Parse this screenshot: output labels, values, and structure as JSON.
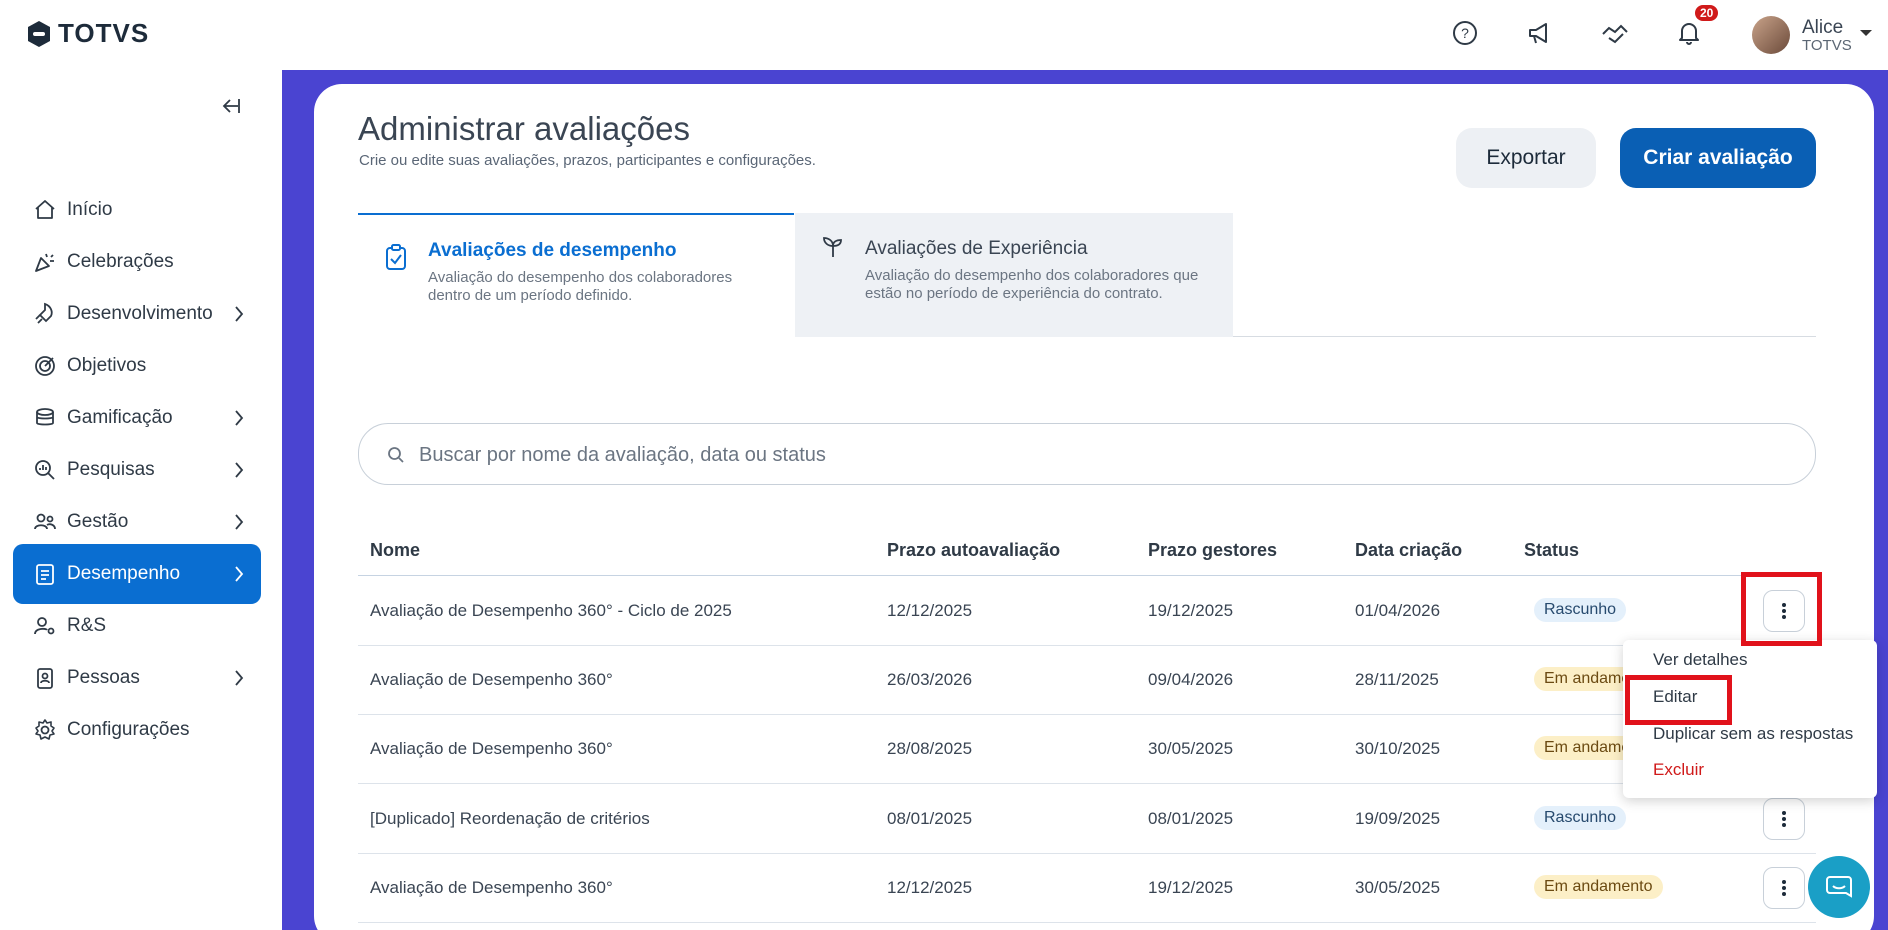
{
  "header": {
    "logo_text": "TOTVS",
    "notification_count": "20",
    "user_name": "Alice",
    "user_org": "TOTVS"
  },
  "sidebar": {
    "items": [
      {
        "label": "Início",
        "icon": "home-icon",
        "has_children": false
      },
      {
        "label": "Celebrações",
        "icon": "party-icon",
        "has_children": false
      },
      {
        "label": "Desenvolvimento",
        "icon": "rocket-icon",
        "has_children": true
      },
      {
        "label": "Objetivos",
        "icon": "target-icon",
        "has_children": false
      },
      {
        "label": "Gamificação",
        "icon": "coins-icon",
        "has_children": true
      },
      {
        "label": "Pesquisas",
        "icon": "search-chart-icon",
        "has_children": true
      },
      {
        "label": "Gestão",
        "icon": "people-icon",
        "has_children": true
      },
      {
        "label": "Desempenho",
        "icon": "clipboard-icon",
        "has_children": true,
        "active": true
      },
      {
        "label": "R&S",
        "icon": "recruit-icon",
        "has_children": false
      },
      {
        "label": "Pessoas",
        "icon": "badge-icon",
        "has_children": true
      },
      {
        "label": "Configurações",
        "icon": "gear-icon",
        "has_children": false
      }
    ]
  },
  "page": {
    "title": "Administrar avaliações",
    "subtitle": "Crie ou edite suas avaliações, prazos, participantes e configurações.",
    "export_label": "Exportar",
    "create_label": "Criar avaliação"
  },
  "tabs": [
    {
      "title": "Avaliações de desempenho",
      "desc": "Avaliação do desempenho dos colaboradores dentro de um período definido.",
      "active": true
    },
    {
      "title": "Avaliações de Experiência",
      "desc": "Avaliação do desempenho dos colaboradores que estão no período de experiência do contrato.",
      "active": false
    }
  ],
  "search": {
    "placeholder": "Buscar por nome da avaliação, data ou status"
  },
  "table": {
    "headers": [
      "Nome",
      "Prazo autoavaliação",
      "Prazo gestores",
      "Data criação",
      "Status"
    ],
    "rows": [
      [
        "Avaliação de Desempenho 360° - Ciclo de 2025",
        "12/12/2025",
        "19/12/2025",
        "01/04/2026",
        "Rascunho"
      ],
      [
        "Avaliação de Desempenho 360°",
        "26/03/2026",
        "09/04/2026",
        "28/11/2025",
        "Em andamento"
      ],
      [
        "Avaliação de Desempenho 360°",
        "28/08/2025",
        "30/05/2025",
        "30/10/2025",
        "Em andamento"
      ],
      [
        "[Duplicado] Reordenação de critérios",
        "08/01/2025",
        "08/01/2025",
        "19/09/2025",
        "Rascunho"
      ],
      [
        "Avaliação de Desempenho 360°",
        "12/12/2025",
        "19/12/2025",
        "30/05/2025",
        "Em andamento"
      ]
    ]
  },
  "menu": {
    "items": [
      "Ver detalhes",
      "Editar",
      "Duplicar sem as respostas",
      "Excluir"
    ]
  },
  "colors": {
    "accent": "#0a6ed1",
    "primary_button": "#0a5fb4",
    "background": "#4a44d1",
    "highlight": "#e1121b",
    "danger": "#d01a1a"
  }
}
